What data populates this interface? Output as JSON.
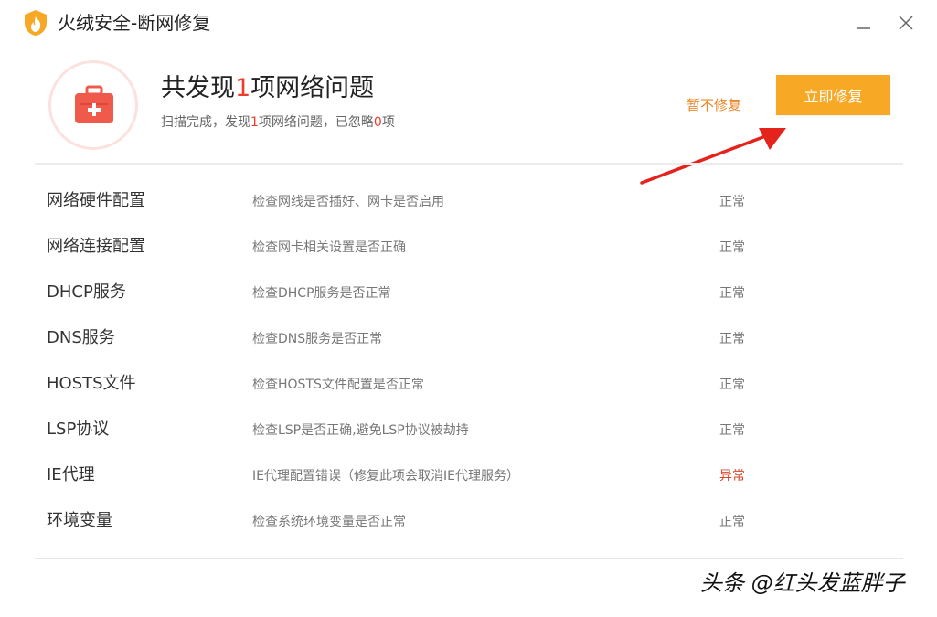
{
  "window": {
    "title": "火绒安全-断网修复",
    "logo_icon": "huorong-flame-shield-icon",
    "minimize_icon": "minimize-icon",
    "close_icon": "close-icon"
  },
  "summary": {
    "headline_prefix": "共发现",
    "headline_count": "1",
    "headline_suffix": "项网络问题",
    "subline_prefix": "扫描完成，发现",
    "subline_found": "1",
    "subline_middle": "项网络问题，已忽略",
    "subline_ignored": "0",
    "subline_suffix": "项",
    "badge_icon": "first-aid-kit-icon"
  },
  "actions": {
    "skip_label": "暂不修复",
    "fix_label": "立即修复"
  },
  "checks": [
    {
      "name": "网络硬件配置",
      "desc": "检查网线是否插好、网卡是否启用",
      "status": "正常",
      "ok": true
    },
    {
      "name": "网络连接配置",
      "desc": "检查网卡相关设置是否正确",
      "status": "正常",
      "ok": true
    },
    {
      "name": "DHCP服务",
      "desc": "检查DHCP服务是否正常",
      "status": "正常",
      "ok": true
    },
    {
      "name": "DNS服务",
      "desc": "检查DNS服务是否正常",
      "status": "正常",
      "ok": true
    },
    {
      "name": "HOSTS文件",
      "desc": "检查HOSTS文件配置是否正常",
      "status": "正常",
      "ok": true
    },
    {
      "name": "LSP协议",
      "desc": "检查LSP是否正确,避免LSP协议被劫持",
      "status": "正常",
      "ok": true
    },
    {
      "name": "IE代理",
      "desc": "IE代理配置错误（修复此项会取消IE代理服务）",
      "status": "异常",
      "ok": false
    },
    {
      "name": "环境变量",
      "desc": "检查系统环境变量是否正常",
      "status": "正常",
      "ok": true
    }
  ],
  "watermark": "头条 @红头发蓝胖子",
  "colors": {
    "accent_orange": "#f7a825",
    "skip_orange": "#e8892a",
    "alert_red": "#ef3b2c",
    "status_bad": "#d9482b"
  }
}
